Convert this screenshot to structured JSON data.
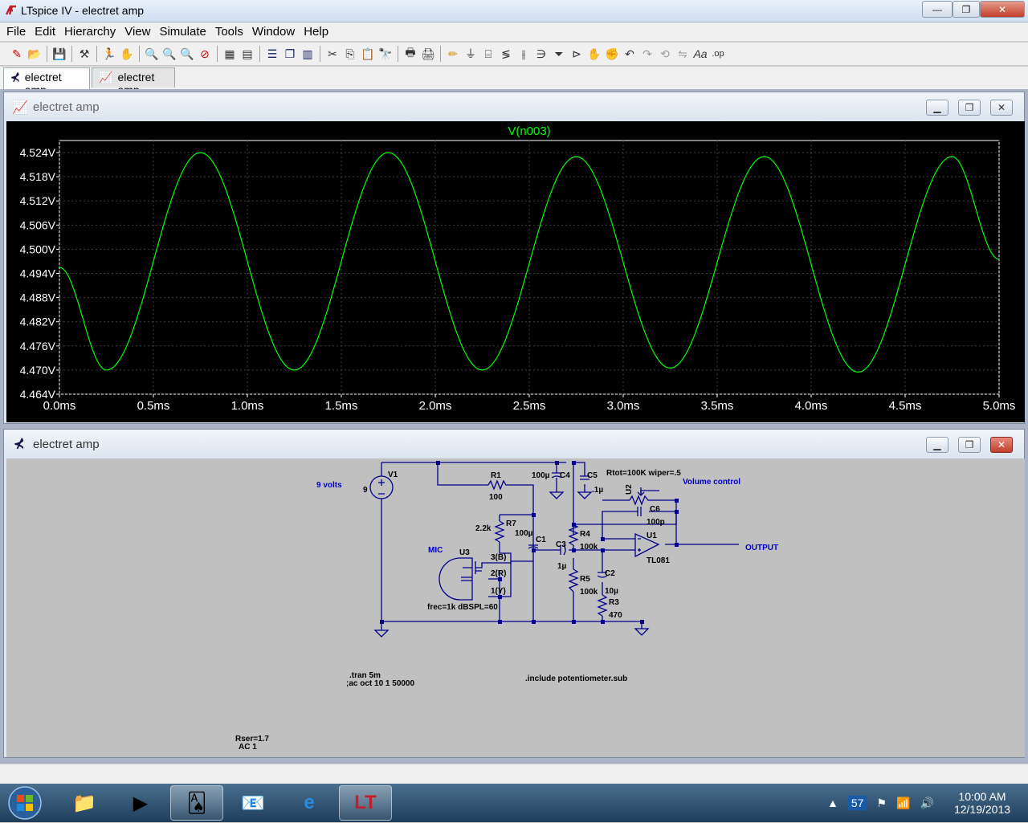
{
  "window": {
    "title": "LTspice IV - electret amp",
    "minimize_glyph": "—",
    "restore_glyph": "❐",
    "close_glyph": "✕"
  },
  "menu": [
    "File",
    "Edit",
    "Hierarchy",
    "View",
    "Simulate",
    "Tools",
    "Window",
    "Help"
  ],
  "toolbar_icons": [
    "new-schematic-icon",
    "open-icon",
    "save-icon",
    "control-panel-icon",
    "run-icon",
    "pan-icon",
    "zoom-in-icon",
    "zoom-icon",
    "zoom-out-icon",
    "zoom-cancel-icon",
    "autorange-icon",
    "grid-icon",
    "tile-horizontal-icon",
    "cascade-icon",
    "tile-vertical-icon",
    "cut-icon",
    "copy-icon",
    "paste-icon",
    "find-icon",
    "print-setup-icon",
    "print-icon",
    "draw-wire-icon",
    "ground-icon",
    "label-net-icon",
    "resistor-icon",
    "capacitor-icon",
    "inductor-icon",
    "diode-icon",
    "component-icon",
    "move-icon",
    "drag-icon",
    "undo-icon",
    "redo-icon",
    "rotate-icon",
    "mirror-icon",
    "text-icon",
    "spice-directive-icon"
  ],
  "tabs": [
    {
      "label": "electret amp",
      "icon": "schematic-icon",
      "active": true
    },
    {
      "label": "electret amp",
      "icon": "waveform-icon",
      "active": false
    }
  ],
  "plot_window": {
    "title": "electret amp",
    "min_glyph": "▁",
    "max_glyph": "❐",
    "close_glyph": "✕"
  },
  "chart_data": {
    "type": "line",
    "title": "V(n003)",
    "series": [
      {
        "name": "V(n003)",
        "color": "#00ff00",
        "x": [
          0.0,
          0.25,
          0.75,
          1.25,
          1.75,
          2.25,
          2.75,
          3.25,
          3.75,
          4.25,
          4.75,
          5.0
        ],
        "y": [
          4.4955,
          4.47,
          4.524,
          4.47,
          4.524,
          4.47,
          4.523,
          4.4705,
          4.523,
          4.4695,
          4.523,
          4.4975
        ]
      }
    ],
    "xlim": [
      0,
      5
    ],
    "ylim": [
      4.464,
      4.527
    ],
    "xticks": [
      "0.0ms",
      "0.5ms",
      "1.0ms",
      "1.5ms",
      "2.0ms",
      "2.5ms",
      "3.0ms",
      "3.5ms",
      "4.0ms",
      "4.5ms",
      "5.0ms"
    ],
    "xtick_values": [
      0,
      0.5,
      1.0,
      1.5,
      2.0,
      2.5,
      3.0,
      3.5,
      4.0,
      4.5,
      5.0
    ],
    "yticks": [
      "4.524V",
      "4.518V",
      "4.512V",
      "4.506V",
      "4.500V",
      "4.494V",
      "4.488V",
      "4.482V",
      "4.476V",
      "4.470V",
      "4.464V"
    ],
    "ytick_values": [
      4.524,
      4.518,
      4.512,
      4.506,
      4.5,
      4.494,
      4.488,
      4.482,
      4.476,
      4.47,
      4.464
    ],
    "grid": true,
    "background": "#000000",
    "axis_color": "#ffffff"
  },
  "schematic_window": {
    "title": "electret amp",
    "min_glyph": "▁",
    "max_glyph": "❐",
    "close_glyph": "✕",
    "labels": {
      "v1": "V1",
      "v1_val": "9",
      "v1_name": "9 volts",
      "r1": "R1",
      "r1_val": "100",
      "c4_val": "100µ",
      "c4": "C4",
      "c5": "C5",
      "c5_val": ".1µ",
      "u2_param": "Rtot=100K wiper=.5",
      "u2": "U2",
      "vol": "Volume control",
      "c6": "C6",
      "c6_val": "100p",
      "r7_val": "2.2k",
      "r7": "R7",
      "c1_val": "100µ",
      "c1": "C1",
      "r4": "R4",
      "r4_val": "100k",
      "u1": "U1",
      "u1_val": "TL081",
      "c3": "C3",
      "c3_val": "1µ",
      "output": "OUTPUT",
      "mic": "MIC",
      "u3": "U3",
      "pin3": "3(B)",
      "pin2": "2(R)",
      "pin1": "1(Y)",
      "r5": "R5",
      "r5_val": "100k",
      "c2": "C2",
      "c2_val": "10µ",
      "r3": "R3",
      "r3_val": "470",
      "mic_param": "frec=1k dBSPL=60",
      "tran": ".tran 5m",
      "ac": ";ac oct 10 1 50000",
      "include": ".include potentiometer.sub",
      "rser": "Rser=1.7",
      "ac1": "AC 1"
    }
  },
  "taskbar": {
    "apps": [
      "folder-icon",
      "media-player-icon",
      "solitaire-icon",
      "outlook-icon",
      "ie-icon",
      "ltspice-icon"
    ],
    "tray_count": "57",
    "time": "10:00 AM",
    "date": "12/19/2013"
  }
}
